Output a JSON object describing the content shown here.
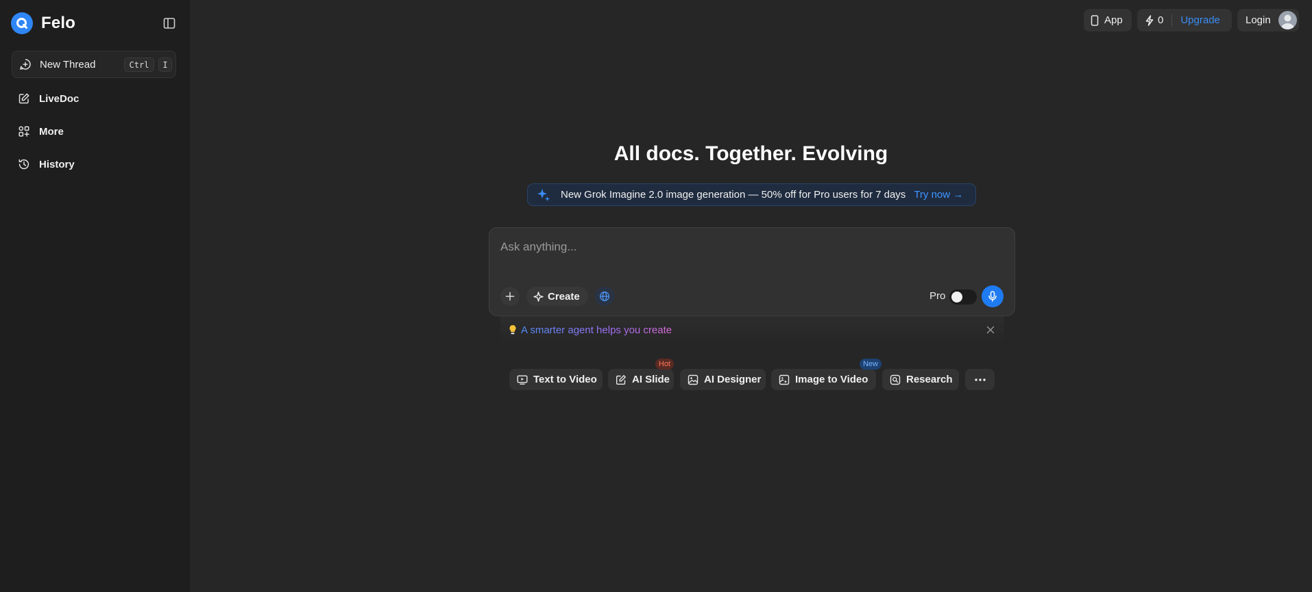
{
  "brand": {
    "name": "Felo"
  },
  "sidebar": {
    "new_thread": {
      "label": "New Thread",
      "shortcut_ctrl": "Ctrl",
      "shortcut_key": "I"
    },
    "items": [
      {
        "label": "LiveDoc",
        "icon": "edit-icon"
      },
      {
        "label": "More",
        "icon": "apps-icon"
      },
      {
        "label": "History",
        "icon": "history-icon"
      }
    ]
  },
  "topbar": {
    "app_label": "App",
    "credits": "0",
    "upgrade_label": "Upgrade",
    "login_label": "Login"
  },
  "main": {
    "headline": "All docs. Together. Evolving",
    "promo": {
      "text": "New Grok Imagine 2.0 image generation — 50% off for Pro users for 7 days",
      "cta": "Try now →"
    },
    "composer": {
      "placeholder": "Ask anything...",
      "create_label": "Create",
      "pro_label": "Pro",
      "pro_enabled": false
    },
    "tip": {
      "text": "A smarter agent helps you create"
    },
    "chips": [
      {
        "label": "Text to Video",
        "icon": "monitor-play-icon",
        "badge": ""
      },
      {
        "label": "AI Slide",
        "icon": "edit-box-icon",
        "badge": "Hot"
      },
      {
        "label": "AI Designer",
        "icon": "image-icon",
        "badge": ""
      },
      {
        "label": "Image to Video",
        "icon": "image-video-icon",
        "badge": "New"
      },
      {
        "label": "Research",
        "icon": "research-icon",
        "badge": ""
      }
    ]
  },
  "colors": {
    "accent": "#1f7bf2",
    "sidebar_bg": "#1e1e1e",
    "page_bg": "#262626",
    "hot_badge": "#ff7a5c",
    "new_badge": "#7ab3ff"
  }
}
